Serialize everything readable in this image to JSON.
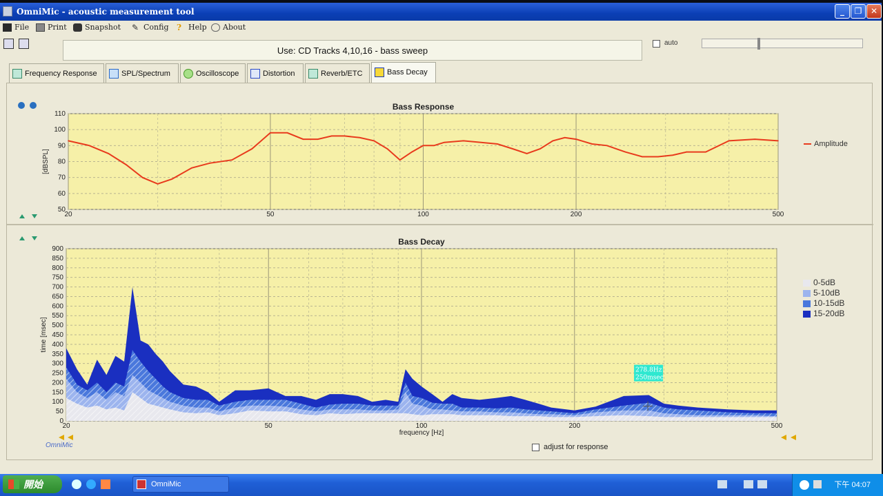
{
  "window": {
    "title": "OmniMic - acoustic measurement tool"
  },
  "menu": [
    {
      "label": "File",
      "icon": "floppy-icon"
    },
    {
      "label": "Print",
      "icon": "printer-icon"
    },
    {
      "label": "Snapshot",
      "icon": "camera-icon"
    },
    {
      "label": "Config",
      "icon": "wrench-icon"
    },
    {
      "label": "Help",
      "icon": "question-icon"
    },
    {
      "label": "About",
      "icon": "speech-bubble-icon"
    }
  ],
  "hint": "Use: CD Tracks 4,10,16 - bass sweep",
  "auto_label": "auto",
  "tabs": [
    {
      "label": "Frequency Response"
    },
    {
      "label": "SPL/Spectrum"
    },
    {
      "label": "Oscilloscope"
    },
    {
      "label": "Distortion"
    },
    {
      "label": "Reverb/ETC"
    },
    {
      "label": "Bass Decay"
    }
  ],
  "chart_data": [
    {
      "type": "line",
      "title": "Bass Response",
      "ylabel": "[dBSPL]",
      "xlabel": "",
      "xscale": "log",
      "xlim": [
        20,
        500
      ],
      "ylim": [
        50,
        110
      ],
      "x_ticks": [
        "20",
        "50",
        "100",
        "200",
        "500"
      ],
      "y_ticks": [
        "50",
        "60",
        "70",
        "80",
        "90",
        "100",
        "110"
      ],
      "legend_position": "right",
      "series": [
        {
          "name": "Amplitude",
          "color": "#e83a1c",
          "x": [
            20,
            22,
            24,
            26,
            28,
            30,
            32,
            35,
            38,
            42,
            46,
            50,
            54,
            58,
            62,
            66,
            70,
            75,
            80,
            85,
            90,
            95,
            100,
            105,
            110,
            120,
            130,
            140,
            150,
            160,
            170,
            180,
            190,
            200,
            215,
            230,
            250,
            270,
            290,
            310,
            330,
            360,
            400,
            450,
            500
          ],
          "y": [
            93,
            90,
            85,
            78,
            70,
            66,
            69,
            76,
            79,
            81,
            88,
            98,
            98,
            94,
            94,
            96,
            96,
            95,
            93,
            88,
            81,
            86,
            90,
            90,
            92,
            93,
            92,
            91,
            88,
            85,
            88,
            93,
            95,
            94,
            91,
            90,
            86,
            83,
            83,
            84,
            86,
            86,
            93,
            94,
            93
          ]
        }
      ]
    },
    {
      "type": "area",
      "title": "Bass Decay",
      "xlabel": "frequency [Hz]",
      "ylabel": "time [msec]",
      "xscale": "log",
      "xlim": [
        20,
        500
      ],
      "ylim": [
        0,
        900
      ],
      "x_ticks": [
        "20",
        "50",
        "100",
        "200",
        "500"
      ],
      "y_ticks": [
        "0",
        "50",
        "100",
        "150",
        "200",
        "250",
        "300",
        "350",
        "400",
        "450",
        "500",
        "550",
        "600",
        "650",
        "700",
        "750",
        "800",
        "850",
        "900"
      ],
      "legend_position": "right",
      "cursor_label": [
        "278.8Hz",
        "250msec"
      ],
      "x": [
        20,
        21,
        22,
        23,
        24,
        25,
        26,
        27,
        28,
        29,
        30,
        31,
        32,
        34,
        36,
        38,
        40,
        43,
        46,
        50,
        54,
        58,
        62,
        66,
        70,
        75,
        80,
        85,
        90,
        93,
        96,
        100,
        105,
        110,
        115,
        120,
        130,
        140,
        150,
        160,
        170,
        180,
        200,
        220,
        250,
        280,
        300,
        320,
        350,
        400,
        450,
        500
      ],
      "series": [
        {
          "name": "0-5dB",
          "color": "#e8e8ee",
          "values": [
            120,
            90,
            70,
            80,
            60,
            70,
            55,
            150,
            120,
            90,
            80,
            70,
            60,
            45,
            40,
            45,
            30,
            40,
            55,
            50,
            50,
            35,
            30,
            40,
            35,
            40,
            40,
            40,
            40,
            40,
            35,
            30,
            35,
            35,
            35,
            30,
            30,
            30,
            25,
            25,
            25,
            20,
            20,
            25,
            30,
            25,
            20,
            20,
            20,
            20,
            20,
            20
          ]
        },
        {
          "name": "5-10dB",
          "color": "#9cb4ee",
          "values": [
            220,
            150,
            120,
            150,
            110,
            150,
            130,
            240,
            200,
            160,
            140,
            120,
            100,
            80,
            70,
            70,
            50,
            70,
            80,
            80,
            75,
            60,
            50,
            60,
            60,
            60,
            55,
            55,
            60,
            150,
            90,
            80,
            60,
            60,
            55,
            50,
            50,
            45,
            45,
            40,
            35,
            35,
            30,
            45,
            55,
            55,
            40,
            35,
            30,
            30,
            30,
            25
          ]
        },
        {
          "name": "10-15dB",
          "color": "#4a78dc",
          "values": [
            280,
            190,
            160,
            200,
            150,
            200,
            180,
            370,
            310,
            260,
            220,
            180,
            150,
            120,
            110,
            110,
            80,
            100,
            110,
            110,
            110,
            90,
            70,
            85,
            90,
            90,
            80,
            80,
            80,
            200,
            130,
            120,
            95,
            90,
            90,
            70,
            70,
            65,
            70,
            60,
            55,
            50,
            40,
            60,
            80,
            95,
            70,
            60,
            55,
            45,
            40,
            40
          ]
        },
        {
          "name": "15-20dB",
          "color": "#1a2fc0",
          "values": [
            380,
            270,
            190,
            320,
            240,
            340,
            310,
            700,
            420,
            400,
            350,
            310,
            260,
            190,
            180,
            150,
            100,
            160,
            160,
            170,
            130,
            130,
            110,
            140,
            140,
            130,
            100,
            110,
            100,
            270,
            220,
            180,
            140,
            100,
            140,
            120,
            110,
            120,
            130,
            110,
            90,
            70,
            55,
            75,
            130,
            135,
            90,
            80,
            70,
            60,
            55,
            55
          ]
        }
      ]
    }
  ],
  "adjust_label": "adjust for response",
  "brand": "OmniMic",
  "taskbar": {
    "start_label": "開始",
    "task_label": "OmniMic",
    "clock": "下午 04:07"
  }
}
